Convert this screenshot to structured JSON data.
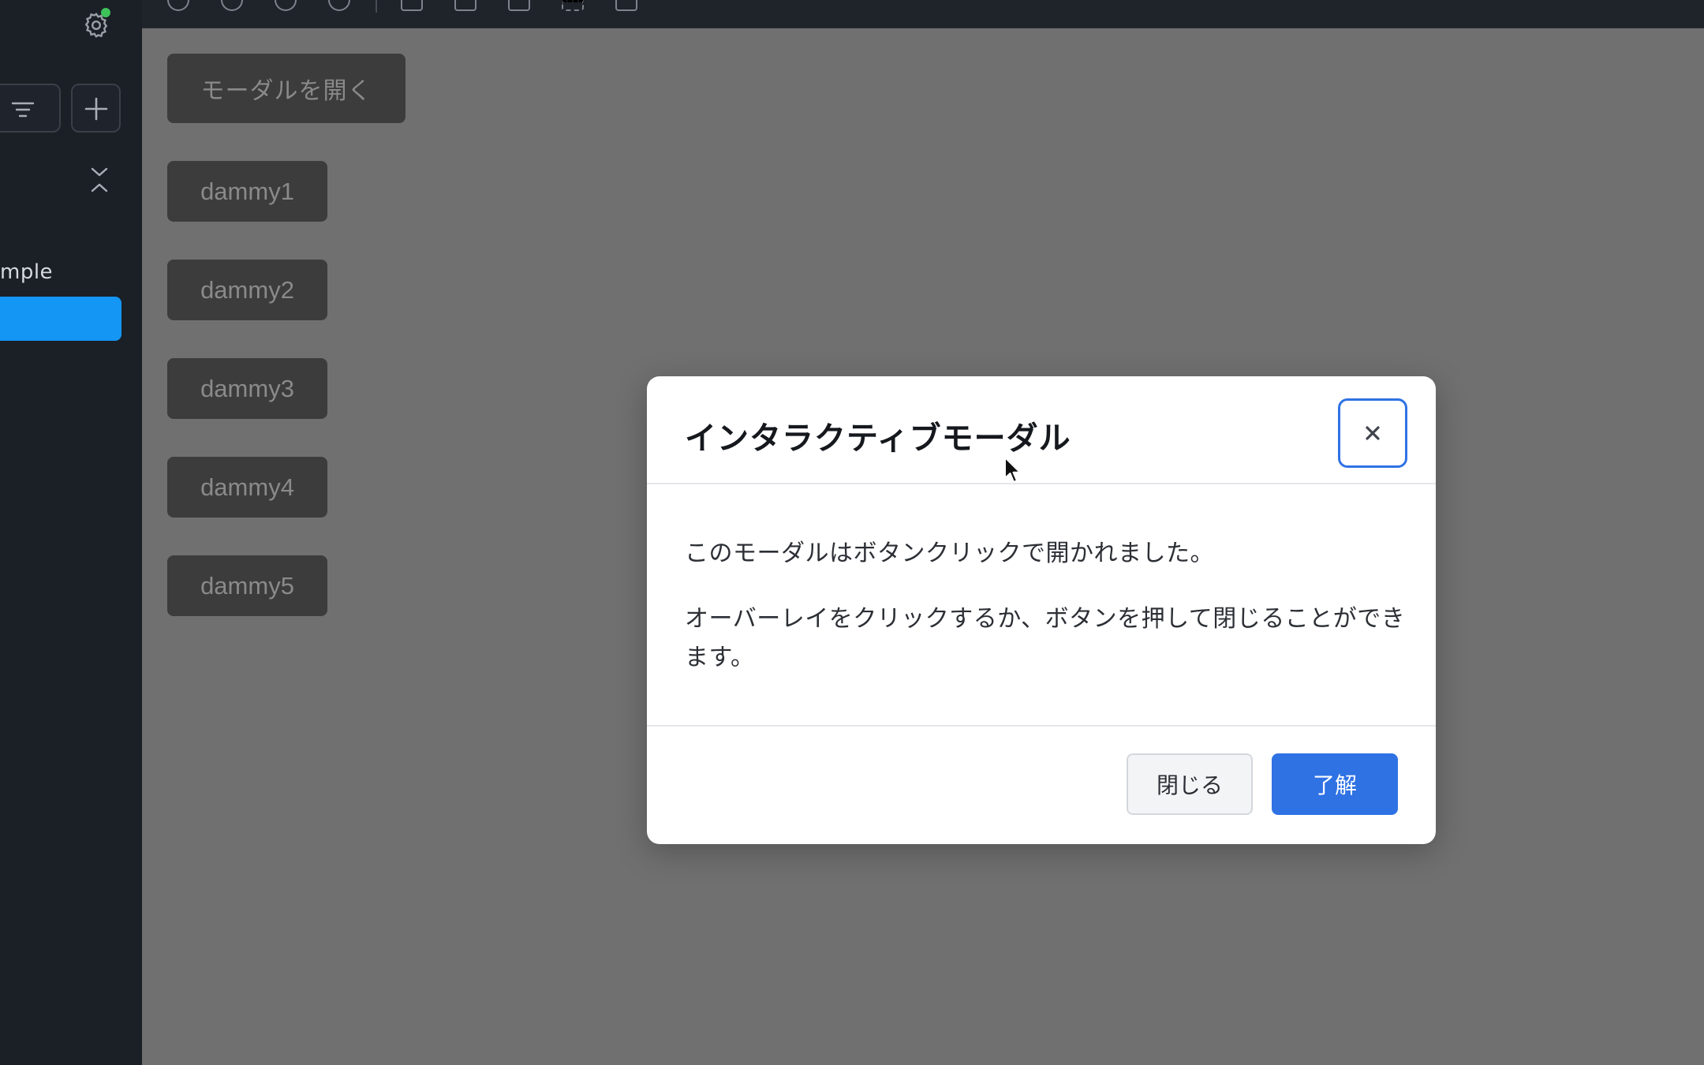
{
  "sidebar": {
    "label": "mple",
    "icons": {
      "settings": "gear-icon",
      "filter": "filter-icon",
      "add": "plus-icon",
      "collapse": "chevron-collapse-icon"
    },
    "status_color": "#3ec25a",
    "active_color": "#1396f4"
  },
  "toolbar": {
    "icons": [
      "refresh-icon",
      "zoom-icon",
      "zoom-in-icon",
      "zoom-out-icon",
      "grid-icon",
      "image-icon",
      "frame-icon",
      "fullscreen-icon",
      "panel-icon"
    ]
  },
  "main": {
    "open_modal_label": "モーダルを開く",
    "dummy_buttons": [
      "dammy1",
      "dammy2",
      "dammy3",
      "dammy4",
      "dammy5"
    ]
  },
  "modal": {
    "title": "インタラクティブモーダル",
    "body": [
      "このモーダルはボタンクリックで開かれました。",
      "オーバーレイをクリックするか、ボタンを押して閉じることができます。"
    ],
    "close_label": "閉じる",
    "ok_label": "了解",
    "accent_color": "#2f72e4"
  }
}
